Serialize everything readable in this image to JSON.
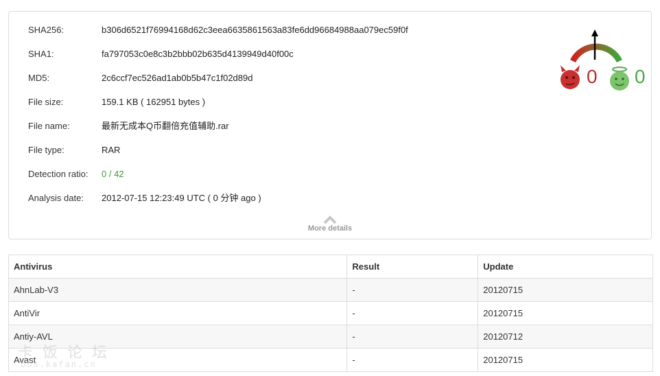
{
  "summary": {
    "rows": [
      {
        "label": "SHA256:",
        "value": "b306d6521f76994168d62c3eea6635861563a83fe6dd96684988aa079ec59f0f"
      },
      {
        "label": "SHA1:",
        "value": "fa797053c0e8c3b2bbb02b635d4139949d40f00c"
      },
      {
        "label": "MD5:",
        "value": "2c6ccf7ec526ad1ab0b5b47c1f02d89d"
      },
      {
        "label": "File size:",
        "value": "159.1 KB ( 162951 bytes )"
      },
      {
        "label": "File name:",
        "value": "最新无成本Q币翻倍充值辅助.rar"
      },
      {
        "label": "File type:",
        "value": "RAR"
      },
      {
        "label": "Detection ratio:",
        "value": "0 / 42"
      },
      {
        "label": "Analysis date:",
        "value": "2012-07-15 12:23:49 UTC ( 0 分钟 ago )"
      }
    ],
    "more_details_label": "More details"
  },
  "votes": {
    "malicious_count": "0",
    "harmless_count": "0",
    "malicious_icon": "devil-face-icon",
    "harmless_icon": "angel-face-icon"
  },
  "colors": {
    "detection_ratio": "#3a9a3a",
    "malicious": "#b83030",
    "harmless": "#4aa84a"
  },
  "table": {
    "headers": {
      "antivirus": "Antivirus",
      "result": "Result",
      "update": "Update"
    },
    "rows": [
      {
        "antivirus": "AhnLab-V3",
        "result": "-",
        "update": "20120715"
      },
      {
        "antivirus": "AntiVir",
        "result": "-",
        "update": "20120715"
      },
      {
        "antivirus": "Antiy-AVL",
        "result": "-",
        "update": "20120712"
      },
      {
        "antivirus": "Avast",
        "result": "-",
        "update": "20120715"
      }
    ]
  },
  "watermark": {
    "text": "卡饭论坛",
    "url": "bbs.kafan.cn"
  }
}
